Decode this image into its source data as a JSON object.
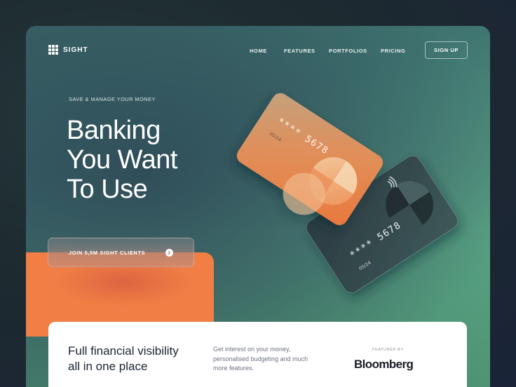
{
  "brand": {
    "name": "SIGHT"
  },
  "nav": {
    "items": [
      {
        "label": "HOME"
      },
      {
        "label": "FEATURES"
      },
      {
        "label": "PORTFOLIOS"
      },
      {
        "label": "PRICING"
      }
    ],
    "signup_label": "SIGN UP"
  },
  "hero": {
    "eyebrow": "SAVE & MANAGE YOUR MONEY",
    "headline_lines": [
      "Banking",
      "You Want",
      "To Use"
    ],
    "cta_label": "JOIN 5,5M SIGHT CLIENTS",
    "cta_icon": "chevron-right-icon"
  },
  "cards": {
    "front": {
      "number_masked": "**** 5678",
      "expiry": "05/24",
      "contactless_icon": "contactless-icon"
    },
    "back": {
      "number_masked": "**** 5678",
      "expiry": "05/24"
    }
  },
  "feature_panel": {
    "title_lines": [
      "Full financial visibility",
      "all in one place"
    ],
    "description": "Get interest on your money, personalised budgeting and much more features.",
    "featured_label": "FEATURED BY",
    "featured_brand": "Bloomberg"
  },
  "colors": {
    "accent_orange": "#f07e45",
    "teal_start": "#3a6868",
    "green_end": "#66c28f",
    "dark_text": "#1c2433"
  }
}
